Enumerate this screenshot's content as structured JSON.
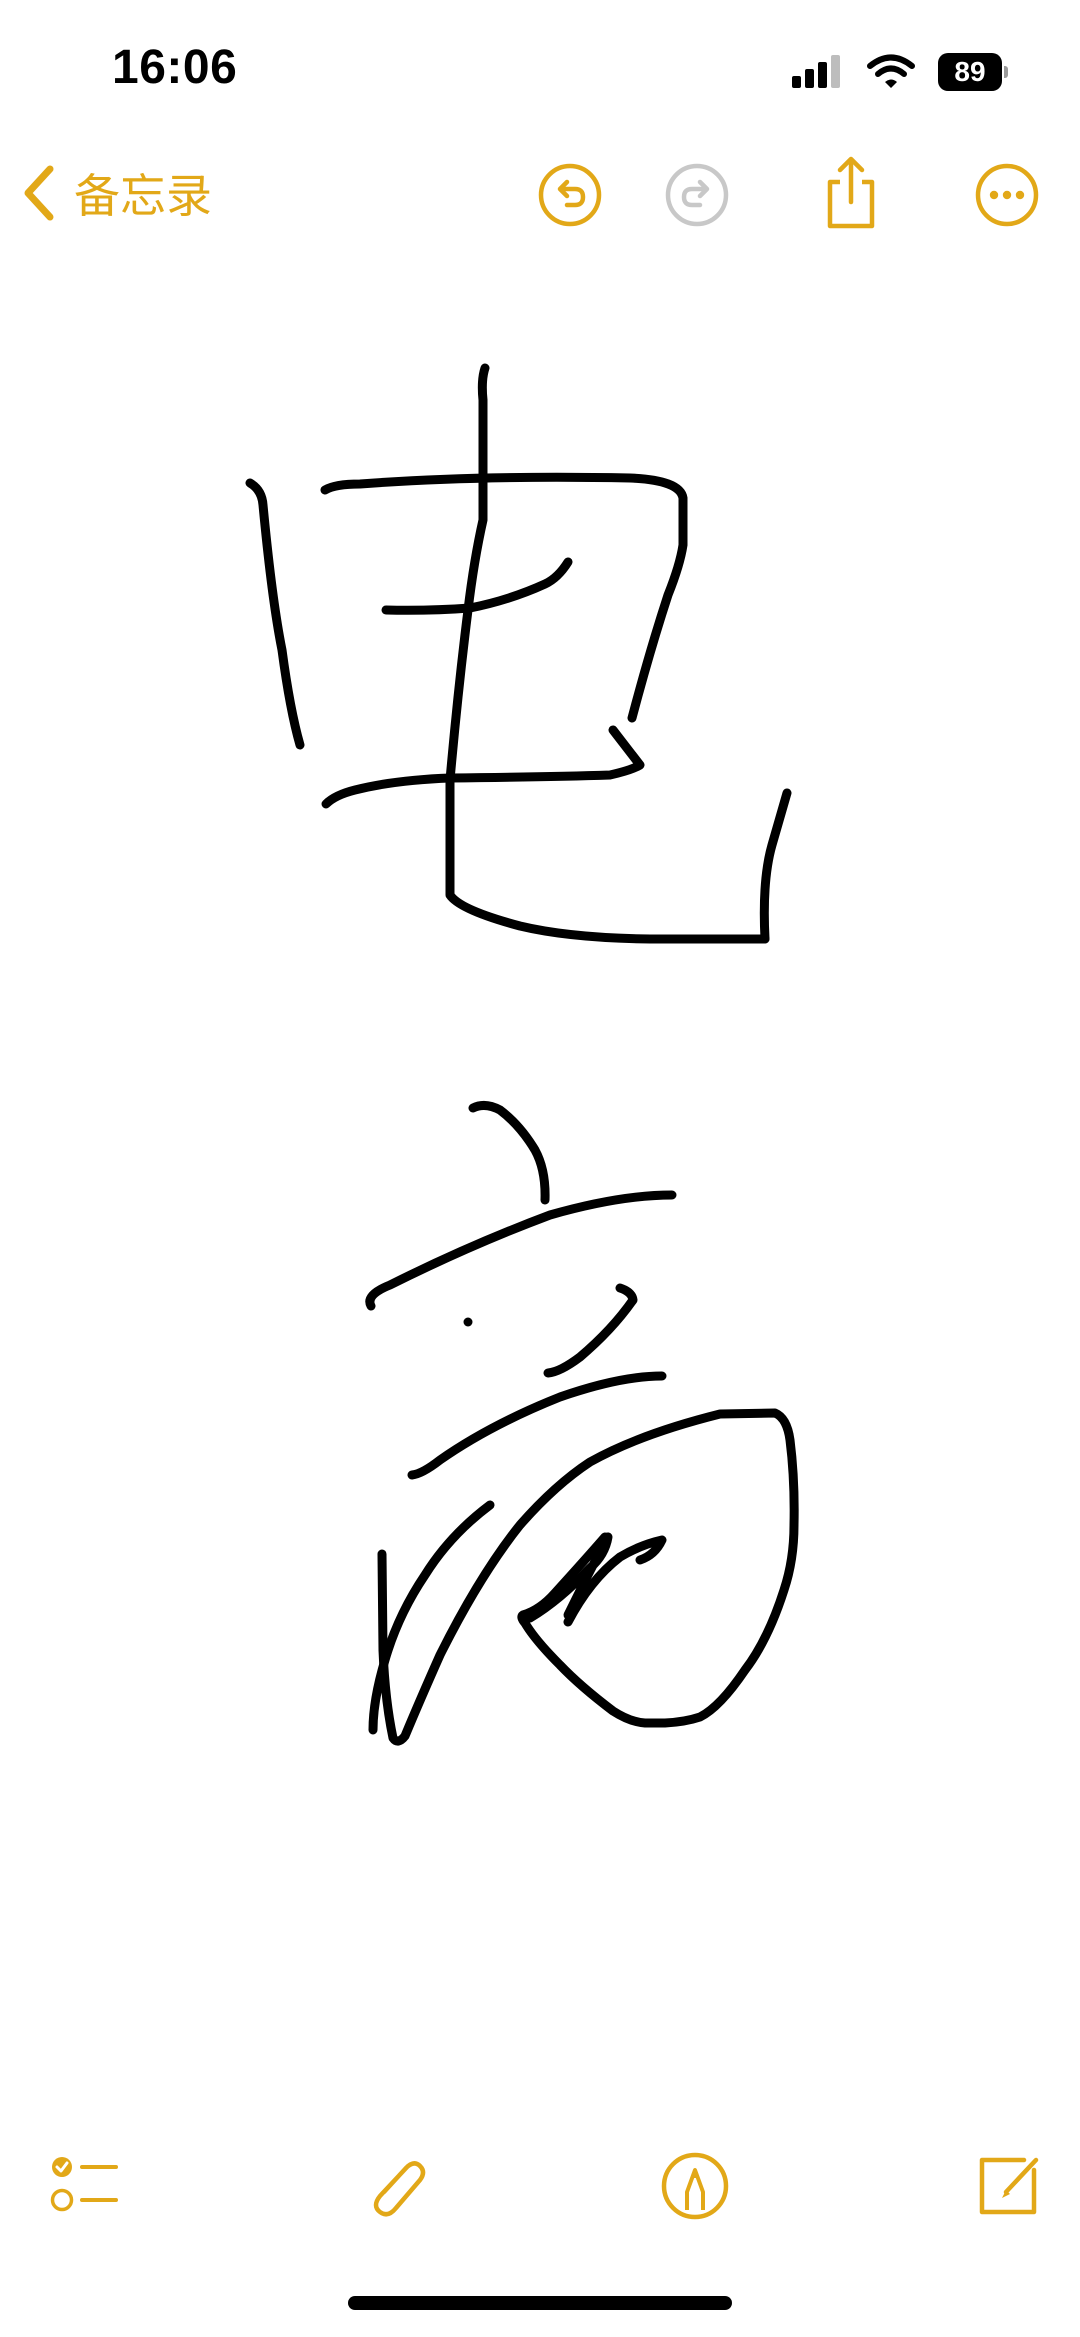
{
  "status_bar": {
    "time": "16:06",
    "battery_level": "89",
    "icons": [
      "cellular-signal-icon",
      "wifi-icon",
      "battery-icon"
    ]
  },
  "nav": {
    "back_label": "备忘录",
    "icons": [
      "chevron-left-icon",
      "undo-icon",
      "redo-icon",
      "share-icon",
      "more-icon"
    ],
    "redo_enabled": false
  },
  "toolbar": {
    "icons": [
      "checklist-icon",
      "paperclip-icon",
      "markup-pen-icon",
      "compose-icon"
    ]
  },
  "colors": {
    "accent": "#e2a818",
    "disabled": "#c8c8c8",
    "ink": "#000000",
    "background": "#ffffff"
  }
}
